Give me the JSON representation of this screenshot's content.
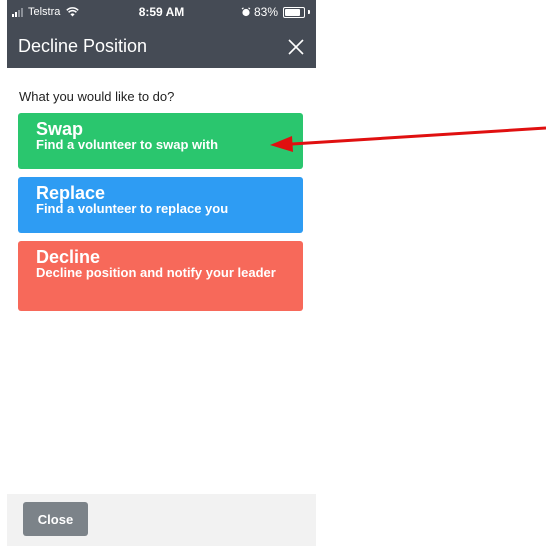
{
  "status_bar": {
    "carrier": "Telstra",
    "time": "8:59 AM",
    "battery": "83%",
    "battery_level": 0.83,
    "icons": [
      "signal-icon",
      "wifi-icon",
      "alarm-icon",
      "battery-icon"
    ]
  },
  "nav": {
    "title": "Decline Position",
    "close_icon": "close-icon"
  },
  "prompt": "What you would like to do?",
  "options": [
    {
      "title": "Swap",
      "subtitle": "Find a volunteer to swap with",
      "color": "#2ac66e"
    },
    {
      "title": "Replace",
      "subtitle": "Find a volunteer to replace you",
      "color": "#2e9cf3"
    },
    {
      "title": "Decline",
      "subtitle": "Decline position and notify your leader",
      "color": "#f7695a"
    }
  ],
  "footer": {
    "close_label": "Close"
  },
  "colors": {
    "header_bg": "#454b55",
    "footer_bg": "#f2f2f2",
    "close_button": "#7c8389",
    "annotation_arrow": "#e01010"
  }
}
